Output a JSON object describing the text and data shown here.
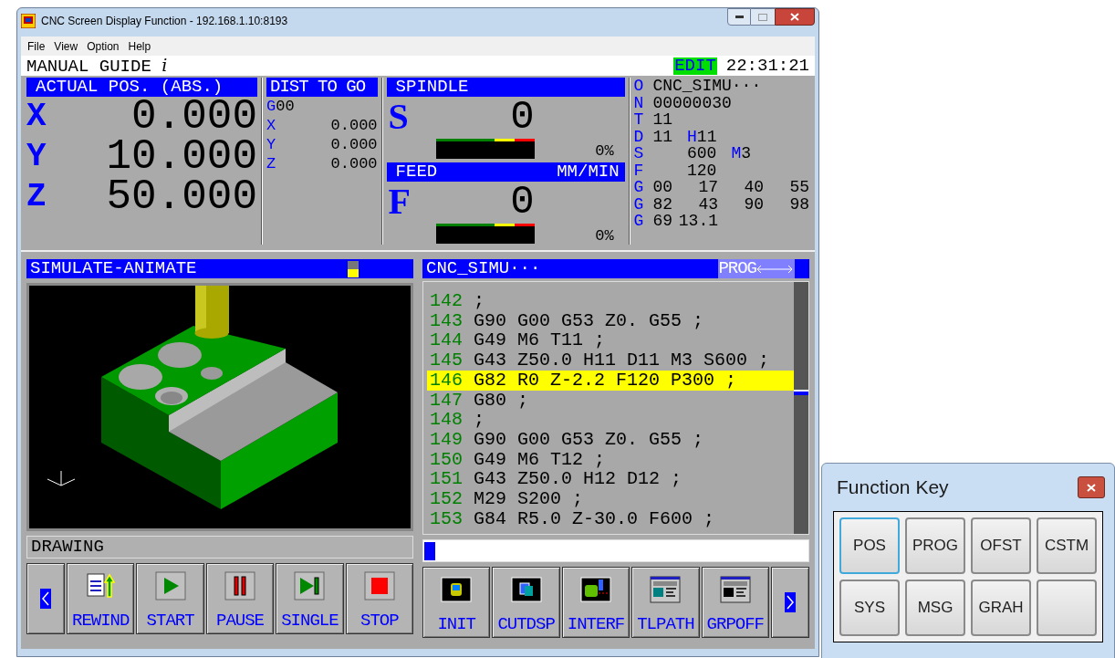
{
  "window": {
    "title": "CNC Screen Display Function - 192.168.1.10:8193",
    "menu": [
      "File",
      "View",
      "Option",
      "Help"
    ]
  },
  "cnc": {
    "header": {
      "title": "MANUAL GUIDE",
      "title_suffix": "i",
      "mode": "EDIT",
      "time": "22:31:21"
    },
    "actual_pos": {
      "title": "ACTUAL POS. (ABS.)",
      "axes": [
        {
          "axis": "X",
          "value": "0.000"
        },
        {
          "axis": "Y",
          "value": "10.000"
        },
        {
          "axis": "Z",
          "value": "50.000"
        }
      ]
    },
    "dist_to_go": {
      "title": "DIST TO GO",
      "mode_letter": "G",
      "mode_code": "00",
      "axes": [
        {
          "axis": "X",
          "value": "0.000"
        },
        {
          "axis": "Y",
          "value": "0.000"
        },
        {
          "axis": "Z",
          "value": "0.000"
        }
      ]
    },
    "spindle": {
      "title": "SPINDLE",
      "letter": "S",
      "value": "0",
      "level": 0,
      "load": "0%"
    },
    "feed": {
      "title": "FEED",
      "unit": "MM/MIN",
      "letter": "F",
      "value": "0",
      "level": 0,
      "load": "0%"
    },
    "modal": [
      {
        "parts": [
          {
            "kind": "letter",
            "text": "O"
          },
          {
            "kind": "code",
            "text": "CNC_SIMU···"
          }
        ]
      },
      {
        "parts": [
          {
            "kind": "letter",
            "text": "N"
          },
          {
            "kind": "code",
            "text": "00000030"
          }
        ]
      },
      {
        "parts": [
          {
            "kind": "letter",
            "text": "T"
          },
          {
            "kind": "code",
            "text": "11"
          }
        ]
      },
      {
        "parts": [
          {
            "kind": "letter",
            "text": "D"
          },
          {
            "kind": "code",
            "text": "11"
          },
          {
            "kind": "letter",
            "text": "H"
          },
          {
            "kind": "code",
            "text": "11"
          }
        ]
      },
      {
        "parts": [
          {
            "kind": "letter",
            "text": "S"
          },
          {
            "kind": "column",
            "text": "600"
          },
          {
            "kind": "letter",
            "text": "M"
          },
          {
            "kind": "code",
            "text": "3"
          }
        ]
      },
      {
        "parts": [
          {
            "kind": "letter",
            "text": "F"
          },
          {
            "kind": "column",
            "text": "120"
          }
        ]
      },
      {
        "parts": [
          {
            "kind": "letter",
            "text": "G"
          },
          {
            "kind": "code",
            "text": "00"
          },
          {
            "kind": "column",
            "text": "17"
          },
          {
            "kind": "column",
            "text": "40"
          },
          {
            "kind": "column",
            "text": "55"
          }
        ]
      },
      {
        "parts": [
          {
            "kind": "letter",
            "text": "G"
          },
          {
            "kind": "code",
            "text": "82"
          },
          {
            "kind": "column",
            "text": "43"
          },
          {
            "kind": "column",
            "text": "90"
          },
          {
            "kind": "column",
            "text": "98"
          }
        ]
      },
      {
        "parts": [
          {
            "kind": "letter",
            "text": "G"
          },
          {
            "kind": "code",
            "text": "69"
          },
          {
            "kind": "column",
            "text": "13.1"
          }
        ]
      }
    ],
    "simulation": {
      "title": "SIMULATE-ANIMATE",
      "status": "DRAWING",
      "keys": [
        {
          "kind": "prev"
        },
        {
          "kind": "rewind",
          "label": "REWIND"
        },
        {
          "kind": "start",
          "label": "START"
        },
        {
          "kind": "pause",
          "label": "PAUSE"
        },
        {
          "kind": "single",
          "label": "SINGLE"
        },
        {
          "kind": "stop",
          "label": "STOP"
        }
      ]
    },
    "program": {
      "title": "CNC_SIMU···",
      "badge": "PROG",
      "lines": [
        {
          "number": "142",
          "code": ";",
          "selected": false
        },
        {
          "number": "143",
          "code": "G90 G00 G53 Z0. G55 ;",
          "selected": false
        },
        {
          "number": "144",
          "code": "G49 M6 T11 ;",
          "selected": false
        },
        {
          "number": "145",
          "code": "G43 Z50.0 H11 D11 M3 S600 ;",
          "selected": false
        },
        {
          "number": "146",
          "code": "G82 R0 Z-2.2 F120 P300 ;",
          "selected": true
        },
        {
          "number": "147",
          "code": "G80 ;",
          "selected": false
        },
        {
          "number": "148",
          "code": ";",
          "selected": false
        },
        {
          "number": "149",
          "code": "G90 G00 G53 Z0. G55 ;",
          "selected": false
        },
        {
          "number": "150",
          "code": "G49 M6 T12 ;",
          "selected": false
        },
        {
          "number": "151",
          "code": "G43 Z50.0 H12 D12 ;",
          "selected": false
        },
        {
          "number": "152",
          "code": "M29 S200 ;",
          "selected": false
        },
        {
          "number": "153",
          "code": "G84 R5.0 Z-30.0 F600 ;",
          "selected": false
        }
      ],
      "keys": [
        {
          "kind": "init",
          "label": "INIT"
        },
        {
          "kind": "cutdsp",
          "label": "CUTDSP"
        },
        {
          "kind": "interf",
          "label": "INTERF"
        },
        {
          "kind": "tlpath",
          "label": "TLPATH"
        },
        {
          "kind": "grpoff",
          "label": "GRPOFF"
        },
        {
          "kind": "next"
        }
      ]
    }
  },
  "function_key": {
    "title": "Function Key",
    "keys": [
      {
        "label": "POS",
        "focused": true
      },
      {
        "label": "PROG",
        "focused": false
      },
      {
        "label": "OFST",
        "focused": false
      },
      {
        "label": "CSTM",
        "focused": false
      },
      {
        "label": "SYS",
        "focused": false
      },
      {
        "label": "MSG",
        "focused": false
      },
      {
        "label": "GRAH",
        "focused": false
      }
    ]
  }
}
